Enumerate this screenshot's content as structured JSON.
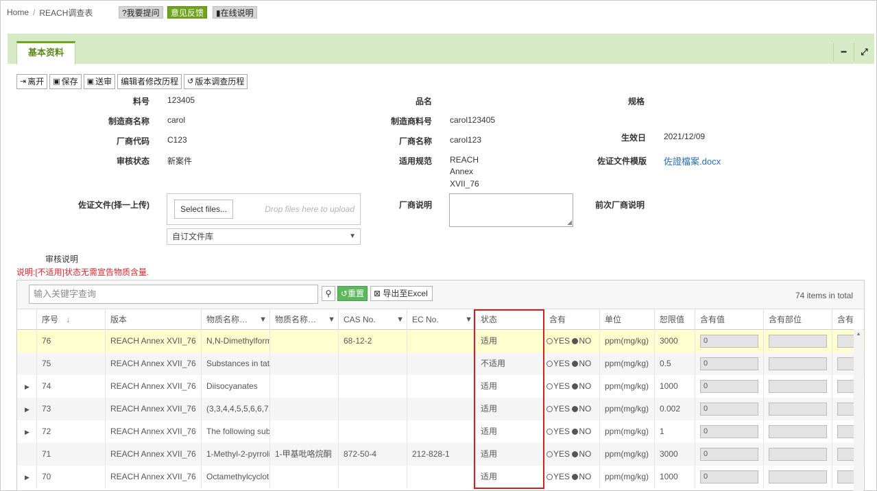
{
  "breadcrumb": {
    "home": "Home",
    "sep": "/",
    "current": "REACH调查表"
  },
  "top_buttons": {
    "ask": "?我要提问",
    "feedback": "意见反馈",
    "help": "在线说明"
  },
  "panel": {
    "tab": "基本资料",
    "minimize_icon": "minus-icon",
    "expand_icon": "expand-icon"
  },
  "toolbar": {
    "leave": "离开",
    "save": "保存",
    "submit": "送审",
    "editor_history": "编辑者修改历程",
    "version_history": "版本调查历程"
  },
  "form": {
    "part_no_label": "料号",
    "part_no": "123405",
    "product_name_label": "品名",
    "spec_label": "规格",
    "maker_name_label": "制造商名称",
    "maker_name": "carol",
    "maker_part_label": "制造商料号",
    "maker_part": "carol123405",
    "effective_label": "生效日",
    "effective": "2021/12/09",
    "vendor_code_label": "厂商代码",
    "vendor_code": "C123",
    "vendor_name_label": "厂商名称",
    "vendor_name": "carol123",
    "review_status_label": "审核状态",
    "review_status": "新案件",
    "regulation_label": "适用规范",
    "regulation_1": "REACH",
    "regulation_2": "Annex",
    "regulation_3": "XVII_76",
    "template_label": "佐证文件模版",
    "template_file": "佐證檔案.docx",
    "evidence_label": "佐证文件(择一上传)",
    "select_files": "Select files...",
    "drop_hint": "Drop files here to upload",
    "library": "自订文件库",
    "vendor_note_label": "厂商说明",
    "prev_vendor_note_label": "前次厂商说明",
    "review_note_label": "审核说明",
    "note": "说明:[不适用]状态无需宣告物质含量."
  },
  "grid": {
    "search_placeholder": "输入关键字查询",
    "reset": "重置",
    "export": "导出至Excel",
    "total": "74 items in total",
    "columns": [
      "序号",
      "版本",
      "物质名称…",
      "物质名称…",
      "CAS No.",
      "EC No.",
      "状态",
      "含有",
      "单位",
      "恕限值",
      "含有值",
      "含有部位",
      "含有"
    ],
    "yes": "YES",
    "no": "NO",
    "rows": [
      {
        "seq": "76",
        "ver": "REACH Annex XVII_76",
        "name_en": "N,N-Dimethylform",
        "name_cn": "",
        "cas": "68-12-2",
        "ec": "",
        "status": "适用",
        "unit": "ppm(mg/kg)",
        "limit": "3000",
        "value": "0"
      },
      {
        "seq": "75",
        "ver": "REACH Annex XVII_76",
        "name_en": "Substances in tat",
        "name_cn": "",
        "cas": "",
        "ec": "",
        "status": "不适用",
        "unit": "ppm(mg/kg)",
        "limit": "0.5",
        "value": "0"
      },
      {
        "seq": "74",
        "ver": "REACH Annex XVII_76",
        "name_en": "Diisocyanates",
        "name_cn": "",
        "cas": "",
        "ec": "",
        "status": "适用",
        "unit": "ppm(mg/kg)",
        "limit": "1000",
        "value": "0"
      },
      {
        "seq": "73",
        "ver": "REACH Annex XVII_76",
        "name_en": "(3,3,4,4,5,5,6,6,7,",
        "name_cn": "",
        "cas": "",
        "ec": "",
        "status": "适用",
        "unit": "ppm(mg/kg)",
        "limit": "0.002",
        "value": "0"
      },
      {
        "seq": "72",
        "ver": "REACH Annex XVII_76",
        "name_en": "The following sub",
        "name_cn": "",
        "cas": "",
        "ec": "",
        "status": "适用",
        "unit": "ppm(mg/kg)",
        "limit": "1",
        "value": "0"
      },
      {
        "seq": "71",
        "ver": "REACH Annex XVII_76",
        "name_en": "1-Methyl-2-pyrroli",
        "name_cn": "1-甲基吡咯烷酮",
        "cas": "872-50-4",
        "ec": "212-828-1",
        "status": "适用",
        "unit": "ppm(mg/kg)",
        "limit": "3000",
        "value": "0"
      },
      {
        "seq": "70",
        "ver": "REACH Annex XVII_76",
        "name_en": "Octamethylcyclot",
        "name_cn": "",
        "cas": "",
        "ec": "",
        "status": "适用",
        "unit": "ppm(mg/kg)",
        "limit": "1000",
        "value": "0"
      }
    ]
  },
  "colors": {
    "accent": "#6ea51d",
    "panel": "#d6eac6",
    "highlight": "#d41f1f",
    "selected_row": "#ffffd0"
  }
}
